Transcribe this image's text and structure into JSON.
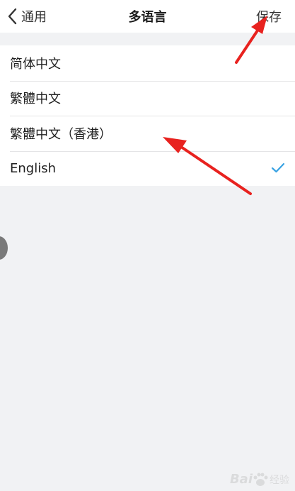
{
  "navbar": {
    "back_label": "通用",
    "title": "多语言",
    "save_label": "保存"
  },
  "languages": [
    {
      "label": "简体中文",
      "selected": false
    },
    {
      "label": "繁體中文",
      "selected": false
    },
    {
      "label": "繁體中文（香港）",
      "selected": false
    },
    {
      "label": "English",
      "selected": true
    }
  ],
  "watermark": {
    "logo_text": "Bai",
    "suffix": "经验"
  },
  "colors": {
    "check": "#3aa3e3",
    "annotation_arrow": "#e8221f"
  },
  "icons": {
    "back": "chevron-left-icon",
    "selected": "checkmark-icon"
  }
}
